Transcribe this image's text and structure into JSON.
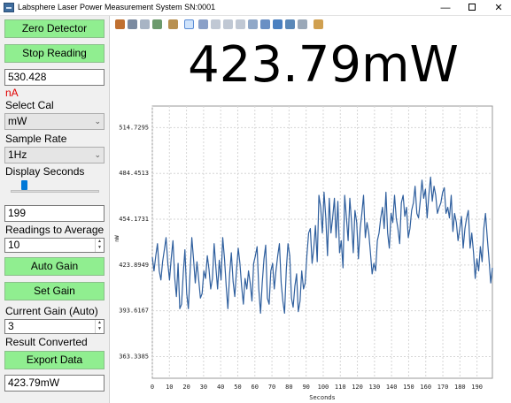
{
  "window": {
    "title": "Labsphere Laser Power Measurement System SN:0001",
    "minimize": "—",
    "close": "✕"
  },
  "left_panel": {
    "zero_detector": "Zero Detector",
    "stop_reading": "Stop Reading",
    "raw_value": "530.428",
    "raw_unit": "nA",
    "select_cal_label": "Select Cal",
    "select_cal_value": "mW",
    "sample_rate_label": "Sample Rate",
    "sample_rate_value": "1Hz",
    "display_seconds_label": "Display Seconds",
    "display_seconds_value": "199",
    "readings_to_average_label": "Readings to Average",
    "readings_to_average_value": "10",
    "auto_gain": "Auto Gain",
    "set_gain": "Set Gain",
    "current_gain_label": "Current Gain (Auto)",
    "current_gain_value": "3",
    "result_converted_label": "Result Converted",
    "export_data": "Export Data",
    "result_value": "423.79mW"
  },
  "toolbar": {
    "icons": [
      "print-icon",
      "save-icon",
      "copy-icon",
      "image-icon",
      "properties-icon",
      "pointer-icon",
      "zoom-in-icon",
      "pan-icon",
      "undo-icon",
      "redo-icon",
      "zoom-out-icon",
      "autoscale-icon",
      "chart-icon",
      "table-icon",
      "magnify-icon",
      "marker-icon"
    ]
  },
  "reading": {
    "display": "423.79mW"
  },
  "chart_data": {
    "type": "line",
    "xlabel": "Seconds",
    "ylabel": "mW",
    "xlim": [
      0,
      199
    ],
    "ylim": [
      349,
      529
    ],
    "yticks": [
      {
        "v": 363.3385,
        "label": "363.3385"
      },
      {
        "v": 393.6167,
        "label": "393.6167"
      },
      {
        "v": 423.8949,
        "label": "423.8949"
      },
      {
        "v": 454.1731,
        "label": "454.1731"
      },
      {
        "v": 484.4513,
        "label": "484.4513"
      },
      {
        "v": 514.7295,
        "label": "514.7295"
      }
    ],
    "xticks": [
      0,
      10,
      20,
      30,
      40,
      50,
      60,
      70,
      80,
      90,
      100,
      110,
      120,
      130,
      140,
      150,
      160,
      170,
      180,
      190
    ],
    "grid": true,
    "color": "#2f5f9e",
    "series": [
      {
        "values": [
          429,
          420,
          430,
          438,
          420,
          414,
          426,
          434,
          442,
          425,
          414,
          428,
          440,
          416,
          403,
          425,
          395,
          398,
          418,
          434,
          405,
          395,
          420,
          442,
          428,
          412,
          426,
          414,
          402,
          405,
          420,
          415,
          430,
          421,
          408,
          415,
          438,
          422,
          408,
          427,
          414,
          442,
          428,
          410,
          395,
          418,
          432,
          413,
          403,
          420,
          435,
          425,
          410,
          398,
          415,
          408,
          420,
          412,
          400,
          425,
          430,
          436,
          408,
          392,
          412,
          428,
          437,
          402,
          398,
          420,
          425,
          408,
          420,
          430,
          438,
          412,
          400,
          392,
          421,
          438,
          430,
          402,
          396,
          410,
          418,
          393,
          400,
          420,
          408,
          412,
          430,
          445,
          448,
          425,
          435,
          450,
          426,
          470,
          462,
          445,
          472,
          455,
          430,
          468,
          445,
          455,
          468,
          442,
          466,
          432,
          440,
          422,
          470,
          455,
          440,
          468,
          452,
          432,
          460,
          452,
          428,
          448,
          458,
          470,
          442,
          452,
          445,
          432,
          418,
          425,
          420,
          440,
          445,
          455,
          462,
          448,
          472,
          445,
          435,
          458,
          452,
          470,
          455,
          448,
          438,
          465,
          470,
          456,
          462,
          442,
          448,
          460,
          465,
          476,
          458,
          455,
          466,
          480,
          468,
          474,
          455,
          470,
          482,
          466,
          476,
          470,
          458,
          462,
          465,
          472,
          475,
          458,
          462,
          455,
          470,
          446,
          458,
          452,
          440,
          448,
          456,
          435,
          448,
          455,
          460,
          435,
          445,
          432,
          415,
          428,
          420,
          436,
          426,
          448,
          458,
          442,
          428,
          412,
          422
        ]
      }
    ]
  }
}
